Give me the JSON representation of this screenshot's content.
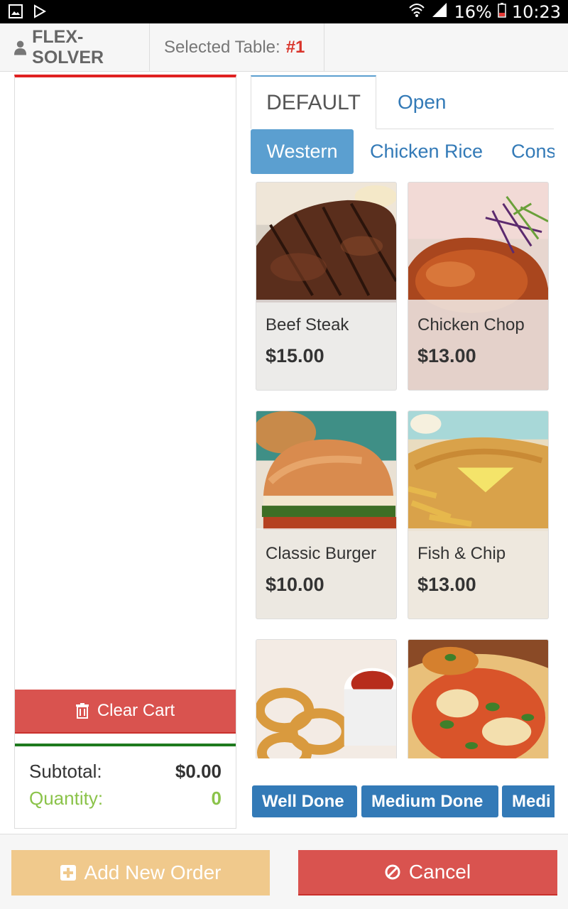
{
  "status_bar": {
    "battery": "16%",
    "time": "10:23",
    "icons": [
      "image-icon",
      "play-store-icon",
      "wifi-icon",
      "signal-icon",
      "battery-icon"
    ]
  },
  "header": {
    "brand": "FLEX-SOLVER",
    "selected_table_label": "Selected Table:",
    "selected_table_value": "#1"
  },
  "cart": {
    "clear_label": "Clear Cart",
    "subtotal_label": "Subtotal:",
    "subtotal_value": "$0.00",
    "quantity_label": "Quantity:",
    "quantity_value": "0"
  },
  "menu_tabs": [
    {
      "label": "DEFAULT",
      "active": true
    },
    {
      "label": "Open",
      "active": false
    }
  ],
  "categories": [
    {
      "label": "Western",
      "active": true
    },
    {
      "label": "Chicken Rice",
      "active": false
    },
    {
      "label": "Cons",
      "active": false
    }
  ],
  "items": [
    {
      "name": "Beef Steak",
      "price": "$15.00"
    },
    {
      "name": "Chicken Chop",
      "price": "$13.00"
    },
    {
      "name": "Classic Burger",
      "price": "$10.00"
    },
    {
      "name": "Fish & Chip",
      "price": "$13.00"
    },
    {
      "name": "",
      "price": ""
    },
    {
      "name": "",
      "price": ""
    }
  ],
  "modifiers": [
    "Well Done",
    "Medium Done",
    "Medi"
  ],
  "actions": {
    "add_label": "Add New Order",
    "cancel_label": "Cancel"
  },
  "colors": {
    "primary": "#337ab7",
    "danger": "#d9534f",
    "warning_light": "#f0c98c",
    "success": "#8bc34a",
    "category_active": "#5b9fd0"
  }
}
